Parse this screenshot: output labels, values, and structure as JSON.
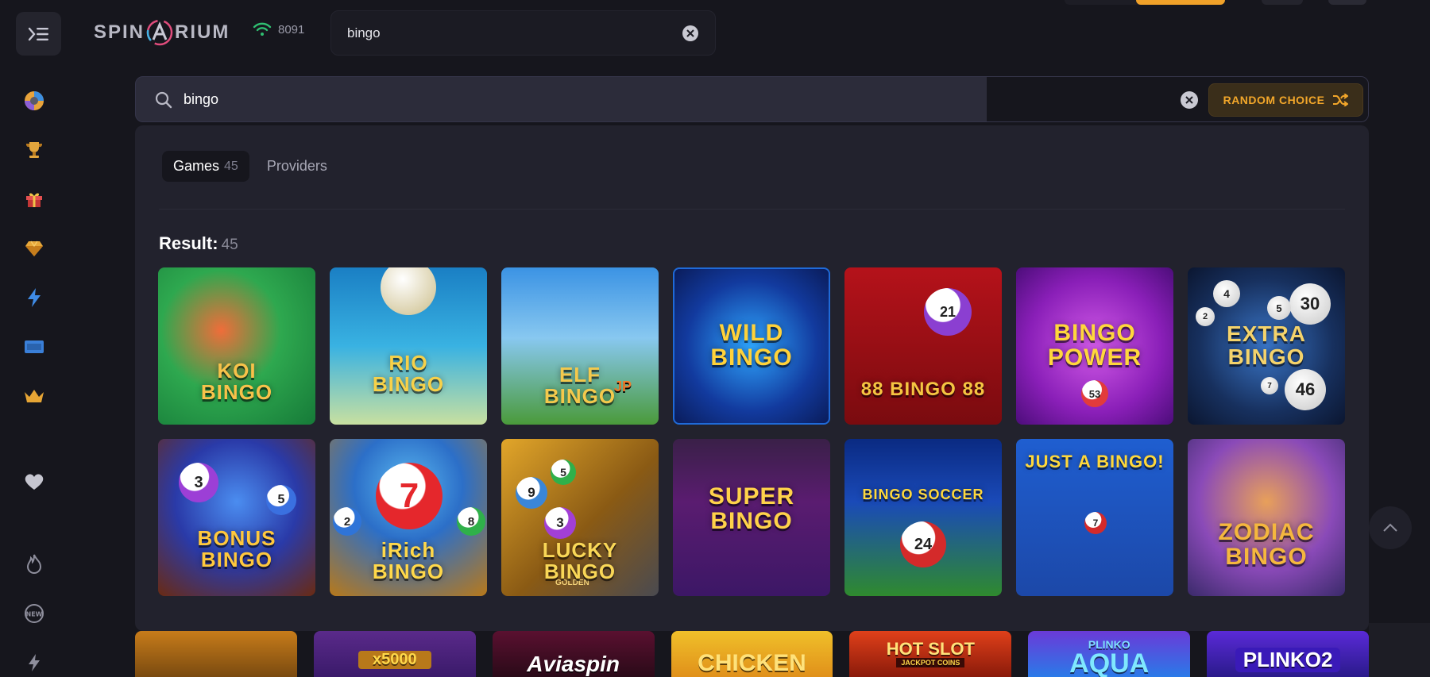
{
  "brand": {
    "logo_left": "SPIN",
    "logo_right": "RIUM"
  },
  "online": {
    "count": "8091"
  },
  "top_search": {
    "value": "bingo"
  },
  "overlay_search": {
    "value": "bingo",
    "random_label": "RANDOM CHOICE"
  },
  "tabs": [
    {
      "label": "Games",
      "count": "45"
    },
    {
      "label": "Providers"
    }
  ],
  "result": {
    "label": "Result:",
    "count": "45"
  },
  "games": [
    {
      "title": "KOI\nBINGO"
    },
    {
      "title": "RIO\nBINGO"
    },
    {
      "title": "ELF\nBINGO",
      "badge": "JP"
    },
    {
      "title": "WILD\nBINGO"
    },
    {
      "title": "88 BINGO 88",
      "ball": "21"
    },
    {
      "title": "BINGO\nPOWER",
      "ball": "53"
    },
    {
      "title": "EXTRA\nBINGO",
      "ball": "30",
      "ball2": "46",
      "ball3": "4",
      "ball4": "5",
      "ball5": "2",
      "ball6": "7"
    },
    {
      "title": "BONUS\nBINGO",
      "ball": "3",
      "ball2": "5"
    },
    {
      "title": "iRich\nBINGO",
      "ball": "7",
      "ball2": "2",
      "ball3": "8"
    },
    {
      "title": "LUCKY\nBINGO",
      "subtitle": "GOLDEN",
      "ball": "3",
      "ball2": "9",
      "ball3": "5"
    },
    {
      "title": "SUPER\nBINGO"
    },
    {
      "title": "BINGO SOCCER",
      "ball": "24"
    },
    {
      "title": "JUST A BINGO!",
      "ball": "7"
    },
    {
      "title": "ZODIAC\nBINGO"
    }
  ],
  "bottom_strip": [
    {
      "label": ""
    },
    {
      "label": "x5000"
    },
    {
      "label": "Aviaspin"
    },
    {
      "label": "CHICKEN"
    },
    {
      "label": "HOT SLOT",
      "sub": "JACKPOT COINS"
    },
    {
      "label": "AQUA",
      "top": "PLINKO"
    },
    {
      "label": "PLINKO2"
    }
  ],
  "colors": {
    "accent": "#f3a72a",
    "bg": "#16161d",
    "panel": "#22222d",
    "online": "#2fbf71"
  },
  "icons": {
    "rail": [
      "menu-icon",
      "casino-chip-icon",
      "trophy-icon",
      "gift-icon",
      "gem-icon",
      "lightning-icon",
      "ticket-icon",
      "crown-icon",
      "heart-icon",
      "fire-icon",
      "new-badge-icon",
      "flash-icon"
    ]
  }
}
